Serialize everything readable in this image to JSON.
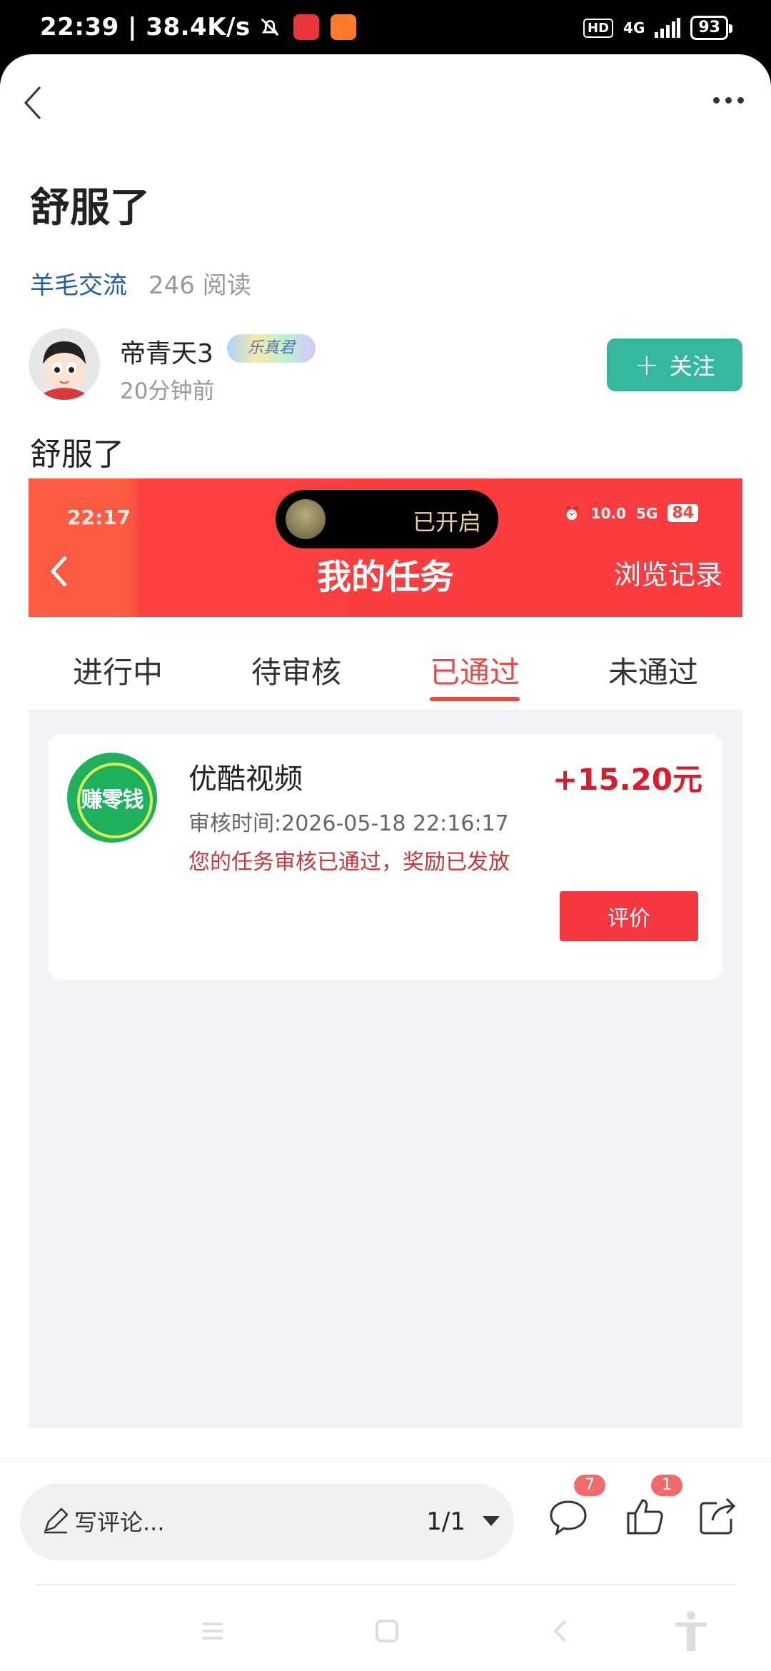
{
  "status_bar": {
    "time_speed": "22:39 | 38.4K/s",
    "hd": "HD",
    "network": "4G",
    "battery": "93"
  },
  "header": {
    "back_icon": "back-chevron-icon",
    "more_icon": "more-dots-icon"
  },
  "post": {
    "title": "舒服了",
    "forum": "羊毛交流",
    "reads": "246 阅读",
    "author": {
      "name": "帝青天3",
      "badge": "乐真君",
      "time": "20分钟前"
    },
    "follow_label": "关注",
    "body": "舒服了"
  },
  "screenshot": {
    "status_time": "22:17",
    "flashlight_status": "已开启",
    "status_speed": "10.0",
    "status_network": "5G",
    "status_battery": "84",
    "title": "我的任务",
    "history": "浏览记录",
    "tabs": [
      {
        "label": "进行中",
        "active": false
      },
      {
        "label": "待审核",
        "active": false
      },
      {
        "label": "已通过",
        "active": true
      },
      {
        "label": "未通过",
        "active": false
      }
    ],
    "task": {
      "logo_text": "赚零钱",
      "name": "优酷视频",
      "amount": "+15.20元",
      "review_time": "审核时间:2026-05-18 22:16:17",
      "status": "您的任务审核已通过，奖励已发放",
      "rate_label": "评价"
    },
    "colors": {
      "header_red": "#fa3b3f",
      "accent_red": "#e84a4a",
      "amount_red": "#d71d2c"
    }
  },
  "bottom_bar": {
    "comment_placeholder": "写评论...",
    "pager": "1/1",
    "comments_count": "7",
    "likes_count": "1"
  },
  "colors": {
    "follow_green": "#35b89c",
    "forum_blue": "#1f5ea8"
  }
}
